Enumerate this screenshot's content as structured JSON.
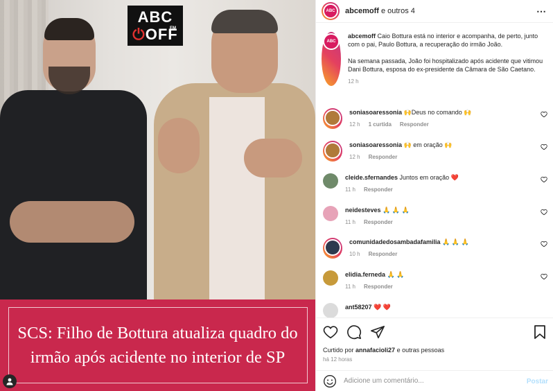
{
  "media": {
    "logo_line1": "ABC",
    "logo_line2a": "",
    "logo_line2b": "OFF",
    "logo_em": "EM",
    "caption": "SCS: Filho de Bottura atualiza quadro do irmão após acidente no interior de SP"
  },
  "header": {
    "username": "abcemoff",
    "others": " e outros 4",
    "more_icon": "⋯"
  },
  "post": {
    "username": "abcemoff",
    "text1": " Caio Bottura está no interior e acompanha, de perto, junto com o pai, Paulo Bottura, a recuperação do irmão João.",
    "text2": "Na semana passada, João foi hospitalizado após acidente que vitimou Dani Bottura, esposa do ex-presidente da Câmara de São Caetano.",
    "time": "12 h"
  },
  "comments": [
    {
      "user": "soniasoaressonia",
      "text": " 🙌Deus no comando 🙌",
      "time": "12 h",
      "likes": "1 curtida",
      "reply": "Responder",
      "avatar_color": "#b07a3a"
    },
    {
      "user": "soniasoaressonia",
      "text": " 🙌 em oração 🙌",
      "time": "12 h",
      "likes": "",
      "reply": "Responder",
      "avatar_color": "#b07a3a"
    },
    {
      "user": "cleide.sfernandes",
      "text": " Juntos em oração ❤️",
      "time": "11 h",
      "likes": "",
      "reply": "Responder",
      "avatar_color": "#6f8a6a"
    },
    {
      "user": "neidesteves",
      "text": " 🙏 🙏 🙏",
      "time": "11 h",
      "likes": "",
      "reply": "Responder",
      "avatar_color": "#e7a3b8"
    },
    {
      "user": "comunidadedosambadafamilia",
      "text": " 🙏 🙏 🙏",
      "time": "10 h",
      "likes": "",
      "reply": "Responder",
      "avatar_color": "#2d3a4e"
    },
    {
      "user": "elidia.ferneda",
      "text": " 🙏 🙏",
      "time": "11 h",
      "likes": "",
      "reply": "Responder",
      "avatar_color": "#c79a3a"
    },
    {
      "user": "ant58207",
      "text": " ❤️ ❤️",
      "time": "",
      "likes": "",
      "reply": "",
      "avatar_color": "#c7c7c7"
    }
  ],
  "footer": {
    "liked_prefix": "Curtido por ",
    "liked_user": "annafacioli27",
    "liked_suffix": " e outras pessoas",
    "time": "há 12 horas",
    "comment_placeholder": "Adicione um comentário...",
    "post_button": "Postar"
  },
  "colors": {
    "caption_bg": "#c9284d",
    "link_blue_disabled": "#b2dffc",
    "muted": "#8e8e8e"
  }
}
